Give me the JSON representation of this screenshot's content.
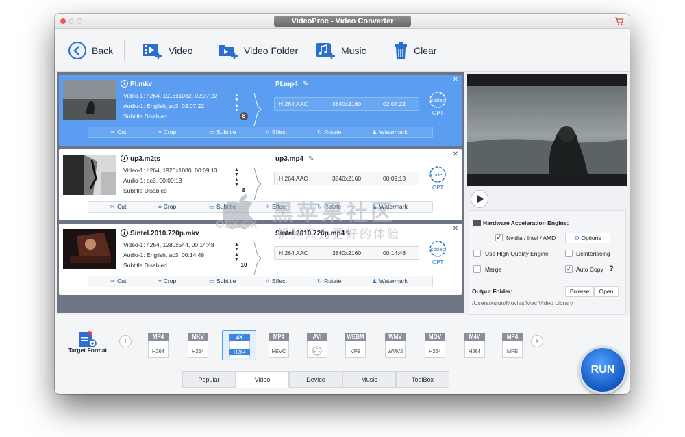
{
  "window": {
    "title": "VideoProc - Video Converter"
  },
  "toolbar": {
    "back": "Back",
    "video": "Video",
    "video_folder": "Video Folder",
    "music": "Music",
    "clear": "Clear"
  },
  "files": [
    {
      "name": "PI.mkv",
      "video": "Video-1: h264, 1916x1032, 02:07:22",
      "audio": "Audio-1: English, ac3, 02:07:22",
      "subtitle": "Subtitle Disabled",
      "badge": "8",
      "output": "PI.mp4",
      "codec": "H.264,AAC",
      "resolution": "3840x2160",
      "duration": "02:07:22",
      "opt": "OPT"
    },
    {
      "name": "up3.m2ts",
      "video": "Video-1: h264, 1920x1080, 00:09:13",
      "audio": "Audio-1: ac3, 00:09:13",
      "subtitle": "Subtitle Disabled",
      "badge": "8",
      "output": "up3.mp4",
      "codec": "H.264,AAC",
      "resolution": "3840x2160",
      "duration": "00:09:13",
      "opt": "OPT"
    },
    {
      "name": "Sintel.2010.720p.mkv",
      "video": "Video-1: h264, 1280x544, 00:14:48",
      "audio": "Audio-1: English, ac3, 00:14:48",
      "subtitle": "Subtitle Disabled",
      "badge": "10",
      "output": "Sintel.2010.720p.mp4",
      "codec": "H.264,AAC",
      "resolution": "3840x2160",
      "duration": "00:14:48",
      "opt": "OPT"
    }
  ],
  "edit": {
    "cut": "Cut",
    "crop": "Crop",
    "subtitle": "Subtitle",
    "effect": "Effect",
    "rotate": "Rotate",
    "watermark": "Watermark"
  },
  "settings": {
    "hw_title": "Hardware Acceleration Engine:",
    "nvidia": "Nvidia / Intel / AMD",
    "options": "Options",
    "hq": "Use High Quality Engine",
    "deinterlacing": "Deinterlacing",
    "merge": "Merge",
    "auto_copy": "Auto Copy",
    "help": "?",
    "output_folder": "Output Folder:",
    "browse": "Browse",
    "open": "Open",
    "path": "/Users/xujun/Movies/Mac Video Library"
  },
  "bottom": {
    "target_format": "Target Format",
    "formats": [
      {
        "top": "MP4",
        "sub": "H264"
      },
      {
        "top": "MKV",
        "sub": "H264"
      },
      {
        "top": "4K",
        "sub": "H264"
      },
      {
        "top": "MP4",
        "sub": "HEVC"
      },
      {
        "top": "AVI",
        "sub": ""
      },
      {
        "top": "WEBM",
        "sub": "VP8"
      },
      {
        "top": "WMV",
        "sub": "WMV2"
      },
      {
        "top": "MOV",
        "sub": "H264"
      },
      {
        "top": "M4V",
        "sub": "H264"
      },
      {
        "top": "MP4",
        "sub": "MPE"
      }
    ],
    "tabs": [
      "Popular",
      "Video",
      "Device",
      "Music",
      "ToolBox"
    ],
    "run": "RUN"
  },
  "watermark_overlay": {
    "site": "OSX.CX",
    "brand": "黑苹果社区",
    "slogan": "折腾只为更好的体验"
  },
  "colors": {
    "selected_card": "#5b9df0",
    "run": "#1757c2",
    "accent": "#2b6fd0",
    "traffic_red": "#ee5a52"
  }
}
